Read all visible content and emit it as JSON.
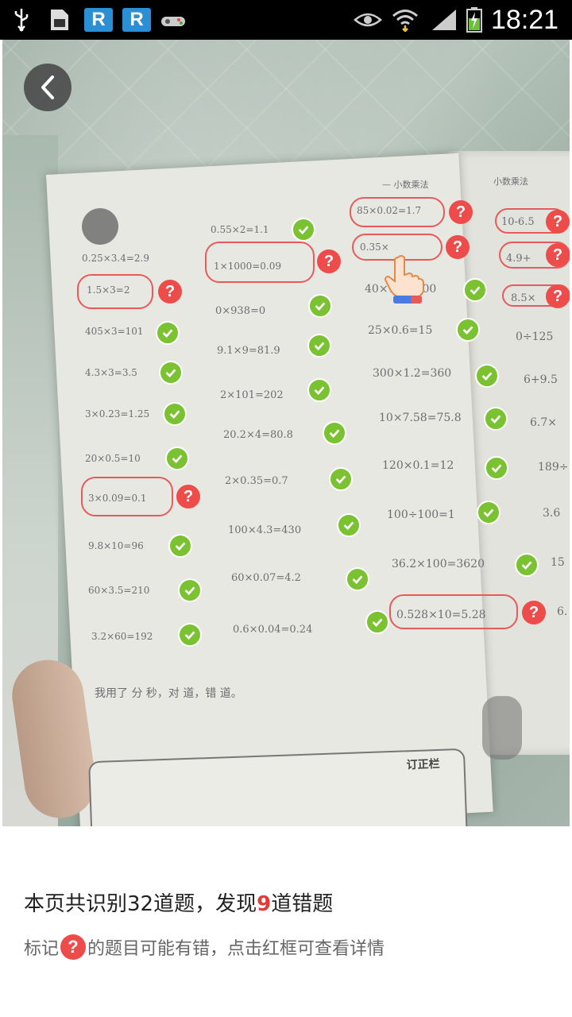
{
  "status_bar": {
    "time": "18:21",
    "icons": [
      "usb-icon",
      "file-icon",
      "app-r-icon",
      "app-r-icon",
      "game-controller-icon",
      "eye-icon",
      "wifi-icon",
      "signal-icon",
      "battery-charging-icon"
    ],
    "r_label": "R"
  },
  "photo": {
    "back_icon": "chevron-left-icon",
    "page_header": [
      "— 小数乘法",
      "小数乘法"
    ],
    "problems": {
      "col1": [
        "0.25×3.4=2.9",
        "1.5×3=2",
        "405×3=101",
        "4.3×3=3.5",
        "3×0.23=1.25",
        "20×0.5=10",
        "3×0.09=0.1",
        "9.8×10=96",
        "60×3.5=210",
        "3.2×60=192"
      ],
      "col2": [
        "0.55×2=1.1",
        "1×1000=0.09",
        "0×938=0",
        "9.1×9=81.9",
        "2×101=202",
        "20.2×4=80.8",
        "2×0.35=0.7",
        "100×4.3=430",
        "60×0.07=4.2",
        "0.6×0.04=0.24"
      ],
      "col3": [
        "85×0.02=1.7",
        "0.35×",
        "40×7.5=300",
        "25×0.6=15",
        "300×1.2=360",
        "10×7.58=75.8",
        "120×0.1=12",
        "100÷100=1",
        "36.2×100=3620",
        "0.528×10=5.28"
      ],
      "col4": [
        "10-6.5",
        "4.9+",
        "8.5×",
        "0÷125",
        "6+9.5",
        "6.7×",
        "189÷",
        "3.6",
        "15",
        "6."
      ]
    },
    "footer_line": "我用了   分   秒，对   道，错   道。",
    "speech_label": "订正栏"
  },
  "summary": {
    "prefix": "本页共识别32道题，发现",
    "error_count": "9",
    "suffix": "道错题"
  },
  "hint": {
    "prefix": "标记",
    "icon_text": "?",
    "suffix": "的题目可能有错，点击红框可查看详情"
  },
  "marker_colors": {
    "correct": "#7ac231",
    "wrong": "#ee4b4b",
    "box": "#e85a5a"
  }
}
